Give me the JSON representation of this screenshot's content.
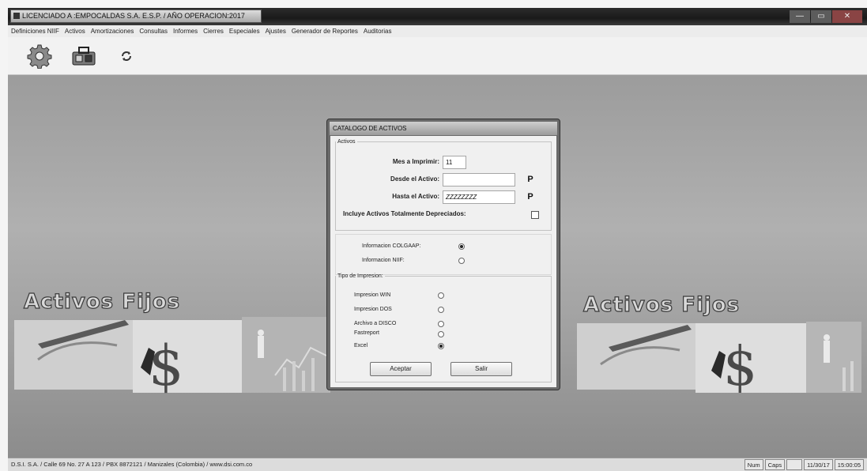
{
  "window": {
    "title": "LICENCIADO A :EMPOCALDAS S.A. E.S.P. / AÑO OPERACION:2017",
    "controls": [
      "—",
      "▭",
      "✕"
    ]
  },
  "menu": [
    "Definiciones NIIF",
    "Activos",
    "Amortizaciones",
    "Consultas",
    "Informes",
    "Cierres",
    "Especiales",
    "Ajustes",
    "Generador de Reportes",
    "Auditorias"
  ],
  "toolbar": {
    "icons": [
      "gear-icon",
      "toolbox-icon",
      "refresh-icon"
    ]
  },
  "banner": {
    "left_title": "Activos Fijos",
    "right_title": "Activos Fijos"
  },
  "dialog": {
    "title": "CATALOGO DE ACTIVOS",
    "group_activos": "Activos",
    "mes_label": "Mes a Imprimir:",
    "mes_value": "11",
    "desde_label": "Desde el Activo:",
    "desde_value": "",
    "hasta_label": "Hasta el Activo:",
    "hasta_value": "ZZZZZZZZ",
    "lookup_glyph": "P",
    "incluye_label": "Incluye Activos Totalmente Depreciados:",
    "info_colgaap": "Informacion COLGAAP:",
    "info_niif": "Informacion NIIF:",
    "group_tipo": "Tipo de Impresion:",
    "print_options": [
      "Impresion WIN",
      "Impresion DOS",
      "Archivo a DISCO",
      "Fastreport",
      "Excel"
    ],
    "selected_print": 4,
    "selected_info": "colgaap",
    "btn_ok": "Aceptar",
    "btn_exit": "Salir"
  },
  "status": {
    "left": "D.S.I. S.A. / Calle 69 No. 27 A 123 / PBX 8872121 / Manizales (Colombia) / www.dsi.com.co",
    "num": "Num",
    "caps": "Caps",
    "ins": "",
    "date": "11/30/17",
    "time": "15:00:05"
  }
}
